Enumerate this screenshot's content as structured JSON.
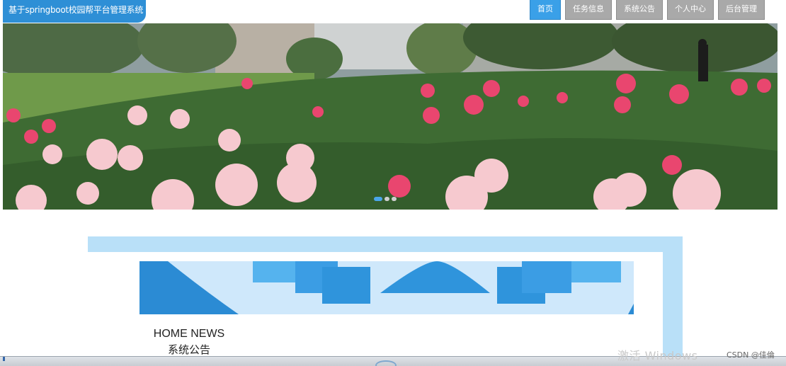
{
  "header": {
    "app_title": "基于springboot校园帮平台管理系统",
    "nav": [
      {
        "label": "首页",
        "active": true
      },
      {
        "label": "任务信息",
        "active": false
      },
      {
        "label": "系统公告",
        "active": false
      },
      {
        "label": "个人中心",
        "active": false
      },
      {
        "label": "后台管理",
        "active": false
      }
    ]
  },
  "carousel": {
    "image": "peony-garden-photo",
    "slide_count": 3,
    "active_slide": 1
  },
  "news_section": {
    "title": "HOME NEWS",
    "subtitle": "系统公告"
  },
  "overlay": {
    "activation_watermark": "激活 Windows",
    "source_watermark": "CSDN @佳倫"
  },
  "colors": {
    "accent": "#3aa0e8",
    "title_bar": "#2e8fd6",
    "nav_inactive": "#a9a9a9",
    "panel_border": "#b9e0f8"
  }
}
